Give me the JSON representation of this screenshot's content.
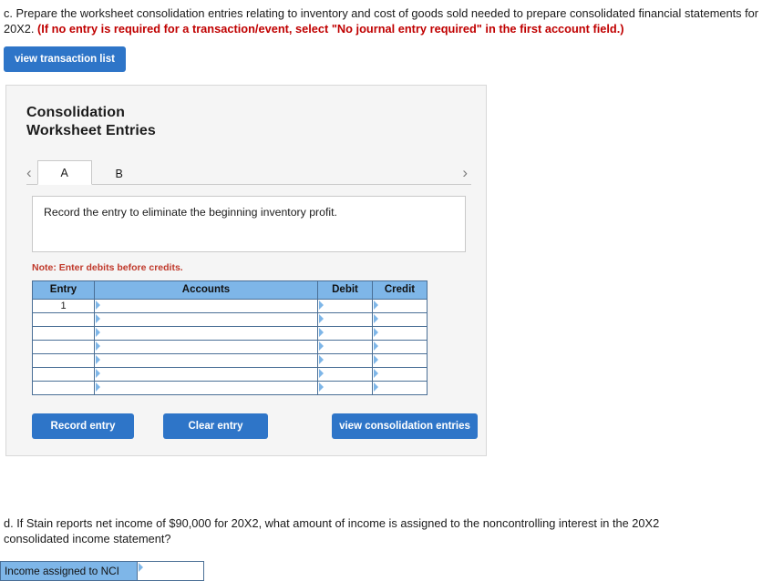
{
  "question_c": {
    "text_part1": "c. Prepare the worksheet consolidation entries relating to inventory and cost of goods sold needed to prepare consolidated financial statements for 20X2. ",
    "text_bold_red": "(If no entry is required for a transaction/event, select \"No journal entry required\" in the first account field.)"
  },
  "view_transaction_list_label": "view transaction list",
  "panel": {
    "title_line1": "Consolidation",
    "title_line2": "Worksheet Entries",
    "prev_arrow": "‹",
    "next_arrow": "›",
    "tabs": [
      {
        "label": "A",
        "active": true
      },
      {
        "label": "B",
        "active": false
      }
    ],
    "instruction": "Record the entry to eliminate the beginning inventory profit.",
    "note": "Note: Enter debits before credits.",
    "table": {
      "headers": [
        "Entry",
        "Accounts",
        "Debit",
        "Credit"
      ],
      "rows": [
        {
          "entry": "1",
          "accounts": "",
          "debit": "",
          "credit": ""
        },
        {
          "entry": "",
          "accounts": "",
          "debit": "",
          "credit": ""
        },
        {
          "entry": "",
          "accounts": "",
          "debit": "",
          "credit": ""
        },
        {
          "entry": "",
          "accounts": "",
          "debit": "",
          "credit": ""
        },
        {
          "entry": "",
          "accounts": "",
          "debit": "",
          "credit": ""
        },
        {
          "entry": "",
          "accounts": "",
          "debit": "",
          "credit": ""
        },
        {
          "entry": "",
          "accounts": "",
          "debit": "",
          "credit": ""
        }
      ]
    },
    "buttons": {
      "record_entry": "Record entry",
      "clear_entry": "Clear entry",
      "view_consolidation_entries": "view consolidation entries"
    }
  },
  "question_d": {
    "text": "d. If Stain reports net income of $90,000 for 20X2, what amount of income is assigned to the noncontrolling interest in the 20X2 consolidated income statement?"
  },
  "nci": {
    "label": "Income assigned to NCI",
    "value": "",
    "placeholder": ""
  },
  "colors": {
    "accent_blue": "#2e75c8",
    "header_blue": "#7eb6e8",
    "note_red": "#c0392b",
    "panel_bg": "#f5f5f5"
  }
}
